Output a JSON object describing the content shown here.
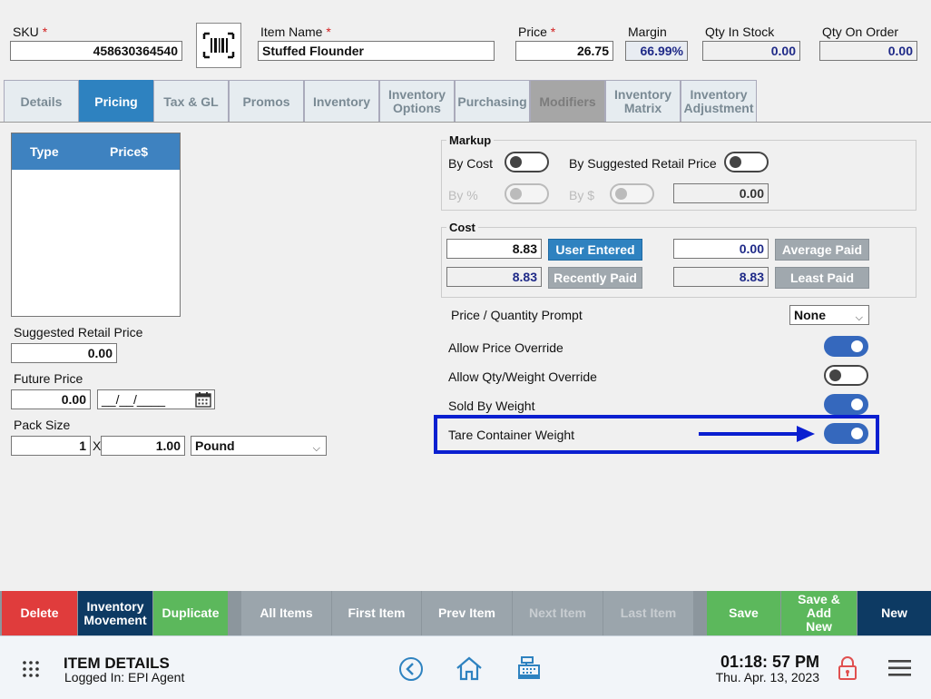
{
  "header": {
    "sku_label": "SKU",
    "sku_value": "458630364540",
    "item_name_label": "Item Name",
    "item_name_value": "Stuffed Flounder",
    "price_label": "Price",
    "price_value": "26.75",
    "margin_label": "Margin",
    "margin_value": "66.99%",
    "qty_in_stock_label": "Qty In Stock",
    "qty_in_stock_value": "0.00",
    "qty_on_order_label": "Qty On Order",
    "qty_on_order_value": "0.00",
    "required_mark": "*"
  },
  "tabs": [
    {
      "label": "Details",
      "state": "normal"
    },
    {
      "label": "Pricing",
      "state": "active"
    },
    {
      "label": "Tax & GL",
      "state": "normal"
    },
    {
      "label": "Promos",
      "state": "normal"
    },
    {
      "label": "Inventory",
      "state": "normal"
    },
    {
      "label": "Inventory Options",
      "state": "normal"
    },
    {
      "label": "Purchasing",
      "state": "normal"
    },
    {
      "label": "Modifiers",
      "state": "disabled"
    },
    {
      "label": "Inventory Matrix",
      "state": "normal"
    },
    {
      "label": "Inventory Adjustment",
      "state": "normal"
    }
  ],
  "price_table": {
    "col_type": "Type",
    "col_price": "Price$"
  },
  "left": {
    "suggested_retail_label": "Suggested Retail Price",
    "suggested_retail_value": "0.00",
    "future_price_label": "Future Price",
    "future_price_value": "0.00",
    "future_date_value": "__/__/____",
    "pack_size_label": "Pack Size",
    "pack_qty": "1",
    "pack_x": "X",
    "pack_amount": "1.00",
    "pack_unit": "Pound"
  },
  "markup": {
    "title": "Markup",
    "by_cost": "By Cost",
    "by_srp": "By Suggested Retail Price",
    "by_pct": "By %",
    "by_dollar": "By $",
    "value": "0.00"
  },
  "cost": {
    "title": "Cost",
    "user_entered_value": "8.83",
    "user_entered_btn": "User Entered",
    "average_paid_value": "0.00",
    "average_paid_btn": "Average Paid",
    "recently_paid_value": "8.83",
    "recently_paid_btn": "Recently Paid",
    "least_paid_value": "8.83",
    "least_paid_btn": "Least Paid"
  },
  "options": {
    "price_qty_prompt_label": "Price / Quantity Prompt",
    "price_qty_prompt_value": "None",
    "allow_price_override": "Allow Price Override",
    "allow_qty_weight_override": "Allow Qty/Weight Override",
    "sold_by_weight": "Sold By Weight",
    "tare_container_weight": "Tare Container Weight"
  },
  "actions": {
    "delete": "Delete",
    "inventory_movement": "Inventory Movement",
    "duplicate": "Duplicate",
    "all_items": "All Items",
    "first_item": "First Item",
    "prev_item": "Prev Item",
    "next_item": "Next Item",
    "last_item": "Last Item",
    "save": "Save",
    "save_add_new": "Save & Add New",
    "new": "New"
  },
  "footer": {
    "title": "ITEM DETAILS",
    "logged_in": "Logged In:  EPI Agent",
    "time": "01:18: 57 PM",
    "date": "Thu. Apr. 13, 2023"
  },
  "colors": {
    "accent": "#2e82c0",
    "toggle_on": "#3568bd",
    "highlight": "#0a1fd0",
    "delete": "#e03c3c",
    "movement": "#0d3a63",
    "green": "#5cb85c",
    "nav_gray": "#9aa4ab",
    "new": "#0d3a63"
  }
}
